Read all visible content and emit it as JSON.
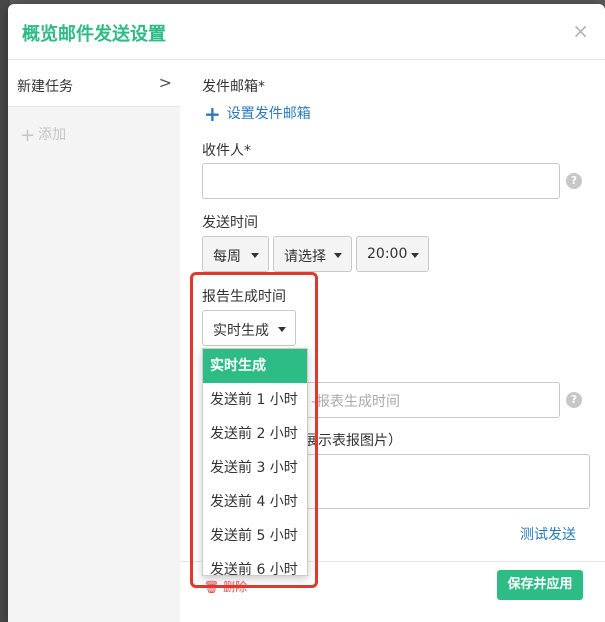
{
  "modal": {
    "title": "概览邮件发送设置",
    "close_label": "×"
  },
  "sidebar": {
    "items": [
      {
        "label": "新建任务",
        "chevron": ">"
      }
    ],
    "add_label": "添加"
  },
  "form": {
    "sender": {
      "label": "发件邮箱*",
      "link_label": "设置发件邮箱"
    },
    "recipients": {
      "label": "收件人*",
      "value": ""
    },
    "send_time": {
      "label": "发送时间",
      "frequency": "每周",
      "day": "请选择",
      "time": "20:00"
    },
    "report_time": {
      "label": "报告生成时间",
      "selected": "实时生成",
      "options": [
        "实时生成",
        "发送前 1 小时",
        "发送前 2 小时",
        "发送前 3 小时",
        "发送前 4 小时",
        "发送前 5 小时",
        "发送前 6 小时"
      ]
    },
    "subject": {
      "placeholder_visible": "-报表生成时间"
    },
    "body": {
      "label_visible": "展示表报图片）"
    },
    "test_send_label": "测试发送"
  },
  "footer": {
    "delete_label": "删除",
    "save_label": "保存并应用"
  },
  "colors": {
    "accent": "#2dbb86",
    "link": "#2a7bbd",
    "danger": "#d9534f",
    "highlight": "#e0392b"
  }
}
